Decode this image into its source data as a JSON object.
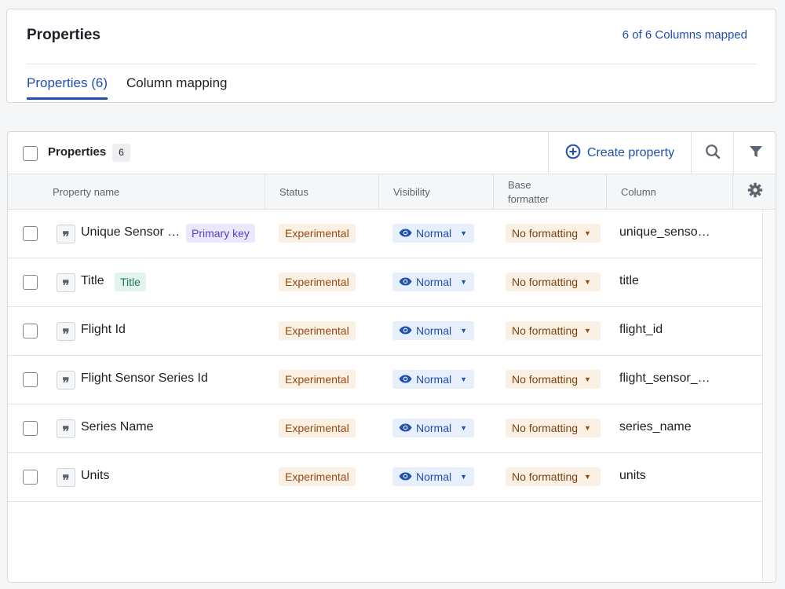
{
  "header": {
    "title": "Properties",
    "mapped_status": "6 of 6 Columns mapped",
    "tabs": [
      {
        "label": "Properties (6)",
        "active": true
      },
      {
        "label": "Column mapping",
        "active": false
      }
    ]
  },
  "toolbar": {
    "title": "Properties",
    "count": "6",
    "create_label": "Create property",
    "create_icon": "plus-circle-icon",
    "search_icon": "search-icon",
    "filter_icon": "filter-icon"
  },
  "columns": {
    "name": "Property name",
    "status": "Status",
    "visibility": "Visibility",
    "base_formatter": "Base formatter",
    "column": "Column",
    "settings_icon": "gear-icon"
  },
  "rows": [
    {
      "type_icon": "quote-icon",
      "name": "Unique Sensor …",
      "tag": "Primary key",
      "tag_type": "primary",
      "status": "Experimental",
      "visibility": "Normal",
      "formatter": "No formatting",
      "column": "unique_senso…"
    },
    {
      "type_icon": "quote-icon",
      "name": "Title",
      "tag": "Title",
      "tag_type": "title",
      "status": "Experimental",
      "visibility": "Normal",
      "formatter": "No formatting",
      "column": "title"
    },
    {
      "type_icon": "quote-icon",
      "name": "Flight Id",
      "tag": "",
      "tag_type": "",
      "status": "Experimental",
      "visibility": "Normal",
      "formatter": "No formatting",
      "column": "flight_id"
    },
    {
      "type_icon": "quote-icon",
      "name": "Flight Sensor Series Id",
      "tag": "",
      "tag_type": "",
      "status": "Experimental",
      "visibility": "Normal",
      "formatter": "No formatting",
      "column": "flight_sensor_…"
    },
    {
      "type_icon": "quote-icon",
      "name": "Series Name",
      "tag": "",
      "tag_type": "",
      "status": "Experimental",
      "visibility": "Normal",
      "formatter": "No formatting",
      "column": "series_name"
    },
    {
      "type_icon": "quote-icon",
      "name": "Units",
      "tag": "",
      "tag_type": "",
      "status": "Experimental",
      "visibility": "Normal",
      "formatter": "No formatting",
      "column": "units"
    }
  ],
  "colors": {
    "accent": "#1f4fb0",
    "status_bg": "#fbf0e4",
    "status_text": "#964a0f",
    "primary_tag_bg": "#ebe7fc",
    "title_tag_bg": "#e3f4ee"
  }
}
